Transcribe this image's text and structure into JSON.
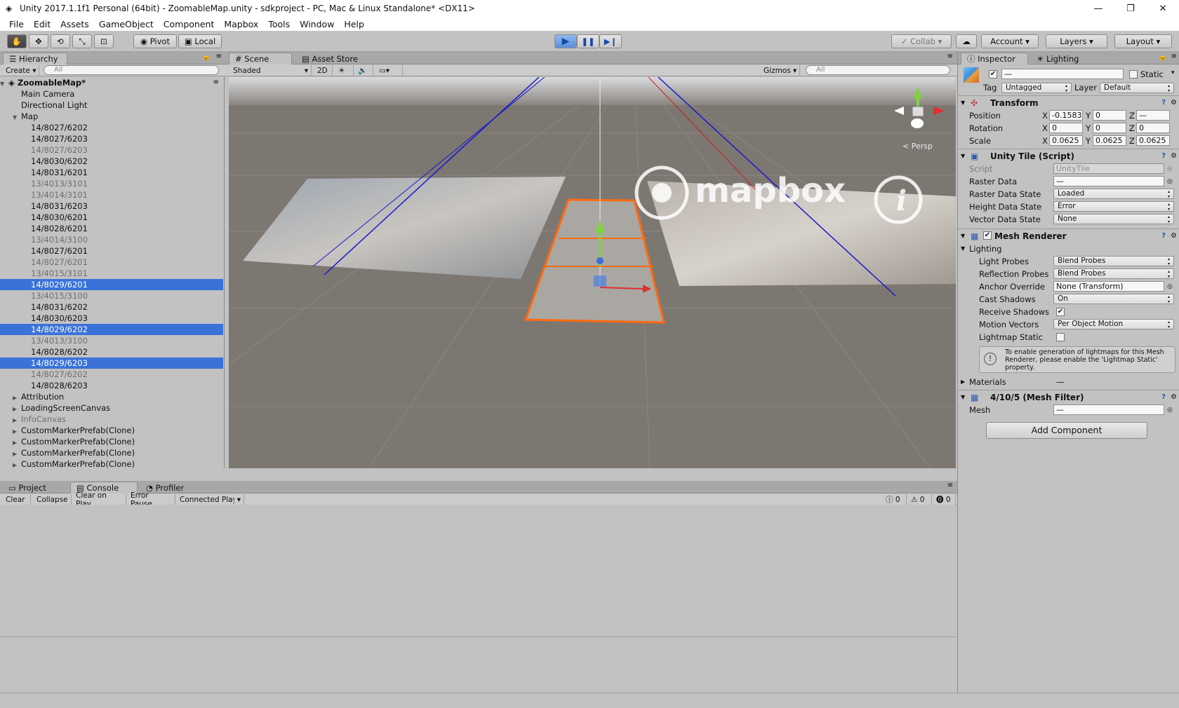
{
  "window": {
    "title": "Unity 2017.1.1f1 Personal (64bit) - ZoomableMap.unity - sdkproject - PC, Mac & Linux Standalone* <DX11>",
    "minimize": "—",
    "maximize": "❐",
    "close": "✕"
  },
  "menu": [
    "File",
    "Edit",
    "Assets",
    "GameObject",
    "Component",
    "Mapbox",
    "Tools",
    "Window",
    "Help"
  ],
  "toolbar": {
    "pivot": "Pivot",
    "local": "Local",
    "collab": "Collab ▾",
    "account": "Account",
    "layers": "Layers",
    "layout": "Layout"
  },
  "hierarchy": {
    "tab": "Hierarchy",
    "create": "Create",
    "search_placeholder": "All",
    "root": "ZoomableMap*",
    "items": [
      {
        "label": "Main Camera",
        "indent": 1,
        "state": "normal",
        "arrow": ""
      },
      {
        "label": "Directional Light",
        "indent": 1,
        "state": "normal",
        "arrow": ""
      },
      {
        "label": "Map",
        "indent": 1,
        "state": "normal",
        "arrow": "▼"
      },
      {
        "label": "14/8027/6202",
        "indent": 2,
        "state": "normal",
        "arrow": ""
      },
      {
        "label": "14/8027/6203",
        "indent": 2,
        "state": "normal",
        "arrow": ""
      },
      {
        "label": "14/8027/6203",
        "indent": 2,
        "state": "dim",
        "arrow": ""
      },
      {
        "label": "14/8030/6202",
        "indent": 2,
        "state": "normal",
        "arrow": ""
      },
      {
        "label": "14/8031/6201",
        "indent": 2,
        "state": "normal",
        "arrow": ""
      },
      {
        "label": "13/4013/3101",
        "indent": 2,
        "state": "dim",
        "arrow": ""
      },
      {
        "label": "13/4014/3101",
        "indent": 2,
        "state": "dim",
        "arrow": ""
      },
      {
        "label": "14/8031/6203",
        "indent": 2,
        "state": "normal",
        "arrow": ""
      },
      {
        "label": "14/8030/6201",
        "indent": 2,
        "state": "normal",
        "arrow": ""
      },
      {
        "label": "14/8028/6201",
        "indent": 2,
        "state": "normal",
        "arrow": ""
      },
      {
        "label": "13/4014/3100",
        "indent": 2,
        "state": "dim",
        "arrow": ""
      },
      {
        "label": "14/8027/6201",
        "indent": 2,
        "state": "normal",
        "arrow": ""
      },
      {
        "label": "14/8027/6201",
        "indent": 2,
        "state": "dim",
        "arrow": ""
      },
      {
        "label": "13/4015/3101",
        "indent": 2,
        "state": "dim",
        "arrow": ""
      },
      {
        "label": "14/8029/6201",
        "indent": 2,
        "state": "sel",
        "arrow": ""
      },
      {
        "label": "13/4015/3100",
        "indent": 2,
        "state": "dim",
        "arrow": ""
      },
      {
        "label": "14/8031/6202",
        "indent": 2,
        "state": "normal",
        "arrow": ""
      },
      {
        "label": "14/8030/6203",
        "indent": 2,
        "state": "normal",
        "arrow": ""
      },
      {
        "label": "14/8029/6202",
        "indent": 2,
        "state": "sel",
        "arrow": ""
      },
      {
        "label": "13/4013/3100",
        "indent": 2,
        "state": "dim",
        "arrow": ""
      },
      {
        "label": "14/8028/6202",
        "indent": 2,
        "state": "normal",
        "arrow": ""
      },
      {
        "label": "14/8029/6203",
        "indent": 2,
        "state": "sel",
        "arrow": ""
      },
      {
        "label": "14/8027/6202",
        "indent": 2,
        "state": "dim",
        "arrow": ""
      },
      {
        "label": "14/8028/6203",
        "indent": 2,
        "state": "normal",
        "arrow": ""
      },
      {
        "label": "Attribution",
        "indent": 1,
        "state": "normal",
        "arrow": "▶"
      },
      {
        "label": "LoadingScreenCanvas",
        "indent": 1,
        "state": "normal",
        "arrow": "▶"
      },
      {
        "label": "InfoCanvas",
        "indent": 1,
        "state": "dim",
        "arrow": "▶"
      },
      {
        "label": "CustomMarkerPrefab(Clone)",
        "indent": 1,
        "state": "normal",
        "arrow": "▶"
      },
      {
        "label": "CustomMarkerPrefab(Clone)",
        "indent": 1,
        "state": "normal",
        "arrow": "▶"
      },
      {
        "label": "CustomMarkerPrefab(Clone)",
        "indent": 1,
        "state": "normal",
        "arrow": "▶"
      },
      {
        "label": "CustomMarkerPrefab(Clone)",
        "indent": 1,
        "state": "normal",
        "arrow": "▶"
      }
    ]
  },
  "scene": {
    "tab_scene": "Scene",
    "tab_asset_store": "Asset Store",
    "shading": "Shaded",
    "mode_2d": "2D",
    "gizmos": "Gizmos",
    "search_placeholder": "All",
    "persp": "< Persp",
    "watermark": "mapbox"
  },
  "inspector": {
    "tab_inspector": "Inspector",
    "tab_lighting": "Lighting",
    "name_value": "—",
    "static_label": "Static",
    "tag_label": "Tag",
    "tag_value": "Untagged",
    "layer_label": "Layer",
    "layer_value": "Default",
    "transform": {
      "title": "Transform",
      "position_label": "Position",
      "rotation_label": "Rotation",
      "scale_label": "Scale",
      "pos": [
        "-0.1583",
        "0",
        "—"
      ],
      "rot": [
        "0",
        "0",
        "0"
      ],
      "scl": [
        "0.0625",
        "0.0625",
        "0.0625"
      ]
    },
    "unity_tile": {
      "title": "Unity Tile (Script)",
      "script_label": "Script",
      "script_value": "UnityTile",
      "raster_data_label": "Raster Data",
      "raster_data_value": "—",
      "raster_state_label": "Raster Data State",
      "raster_state_value": "Loaded",
      "height_state_label": "Height Data State",
      "height_state_value": "Error",
      "vector_state_label": "Vector Data State",
      "vector_state_value": "None"
    },
    "mesh_renderer": {
      "title": "Mesh Renderer",
      "lighting_label": "Lighting",
      "light_probes_label": "Light Probes",
      "light_probes_value": "Blend Probes",
      "reflection_label": "Reflection Probes",
      "reflection_value": "Blend Probes",
      "anchor_label": "Anchor Override",
      "anchor_value": "None (Transform)",
      "cast_label": "Cast Shadows",
      "cast_value": "On",
      "receive_label": "Receive Shadows",
      "motion_label": "Motion Vectors",
      "motion_value": "Per Object Motion",
      "lightmap_label": "Lightmap Static",
      "info": "To enable generation of lightmaps for this Mesh Renderer, please enable the 'Lightmap Static' property.",
      "materials_label": "Materials",
      "materials_value": "—"
    },
    "mesh_filter": {
      "title": "4/10/5 (Mesh Filter)",
      "mesh_label": "Mesh",
      "mesh_value": "—"
    },
    "add_component": "Add Component"
  },
  "console": {
    "tab_project": "Project",
    "tab_console": "Console",
    "tab_profiler": "Profiler",
    "clear": "Clear",
    "collapse": "Collapse",
    "clear_on_play": "Clear on Play",
    "error_pause": "Error Pause",
    "connected": "Connected Player",
    "info_count": "0",
    "warn_count": "0",
    "error_count": "0"
  }
}
